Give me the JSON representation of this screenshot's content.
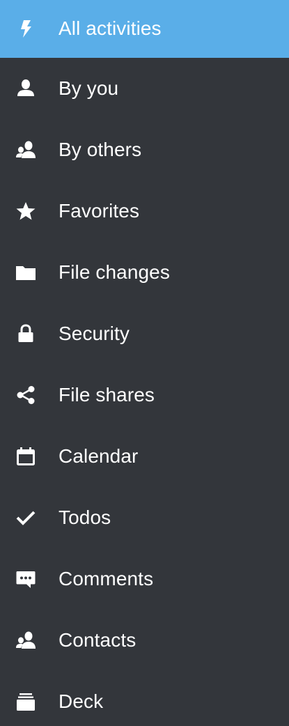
{
  "colors": {
    "background": "#33363b",
    "active": "#5aaee8",
    "text": "#ffffff"
  },
  "navigation": {
    "items": [
      {
        "label": "All activities",
        "icon": "lightning-icon",
        "active": true
      },
      {
        "label": "By you",
        "icon": "user-icon",
        "active": false
      },
      {
        "label": "By others",
        "icon": "users-icon",
        "active": false
      },
      {
        "label": "Favorites",
        "icon": "star-icon",
        "active": false
      },
      {
        "label": "File changes",
        "icon": "folder-icon",
        "active": false
      },
      {
        "label": "Security",
        "icon": "lock-icon",
        "active": false
      },
      {
        "label": "File shares",
        "icon": "share-icon",
        "active": false
      },
      {
        "label": "Calendar",
        "icon": "calendar-icon",
        "active": false
      },
      {
        "label": "Todos",
        "icon": "checkmark-icon",
        "active": false
      },
      {
        "label": "Comments",
        "icon": "comment-icon",
        "active": false
      },
      {
        "label": "Contacts",
        "icon": "contacts-icon",
        "active": false
      },
      {
        "label": "Deck",
        "icon": "deck-icon",
        "active": false
      }
    ]
  }
}
